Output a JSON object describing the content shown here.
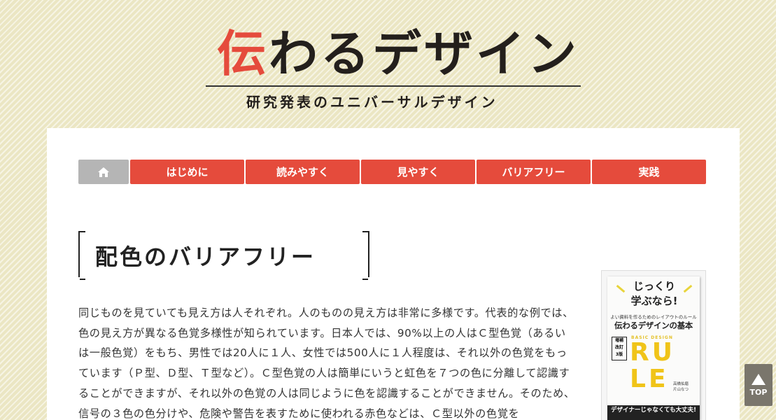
{
  "header": {
    "logo_first_char": "伝",
    "logo_rest": "わるデザイン",
    "logo_subtitle": "研究発表のユニバーサルデザイン"
  },
  "nav": {
    "home_icon": "home-icon",
    "items": [
      {
        "label": "はじめに"
      },
      {
        "label": "読みやすく"
      },
      {
        "label": "見やすく"
      },
      {
        "label": "バリアフリー"
      },
      {
        "label": "実践"
      }
    ]
  },
  "page": {
    "title": "配色のバリアフリー",
    "body": "同じものを見ていても見え方は人それぞれ。人のものの見え方は非常に多様です。代表的な例では、色の見え方が異なる色覚多様性が知られています。日本人では、90%以上の人はＣ型色覚（あるいは一般色覚）をもち、男性では20人に１人、女性では500人に１人程度は、それ以外の色覚をもっています（Ｐ型、Ｄ型、Ｔ型など）。Ｃ型色覚の人は簡単にいうと虹色を７つの色に分離して認識することができますが、それ以外の色覚の人は同じように色を認識することができません。そのため、信号の３色の色分けや、危険や警告を表すために使われる赤色などは、Ｃ型以外の色覚を"
  },
  "book_ad": {
    "bubble_line1": "じっくり",
    "bubble_line2": "学ぶなら!",
    "small_text": "よい資料を作るためのレイアウトのルール",
    "main_title": "伝わるデザインの基本",
    "badge_line1": "増補",
    "badge_line2": "改訂",
    "badge_line3": "3版",
    "basic_label": "BASIC DESIGN",
    "rule_text": "RULE",
    "author1": "高橋佑磨",
    "author2": "片山なつ",
    "banner": "デザイナーじゃなくても大丈夫!"
  },
  "to_top": {
    "label": "TOP"
  },
  "colors": {
    "accent": "#e54b3c",
    "home": "#b5b5b5",
    "background": "#ebe6c3",
    "to_top": "#7a766c"
  }
}
